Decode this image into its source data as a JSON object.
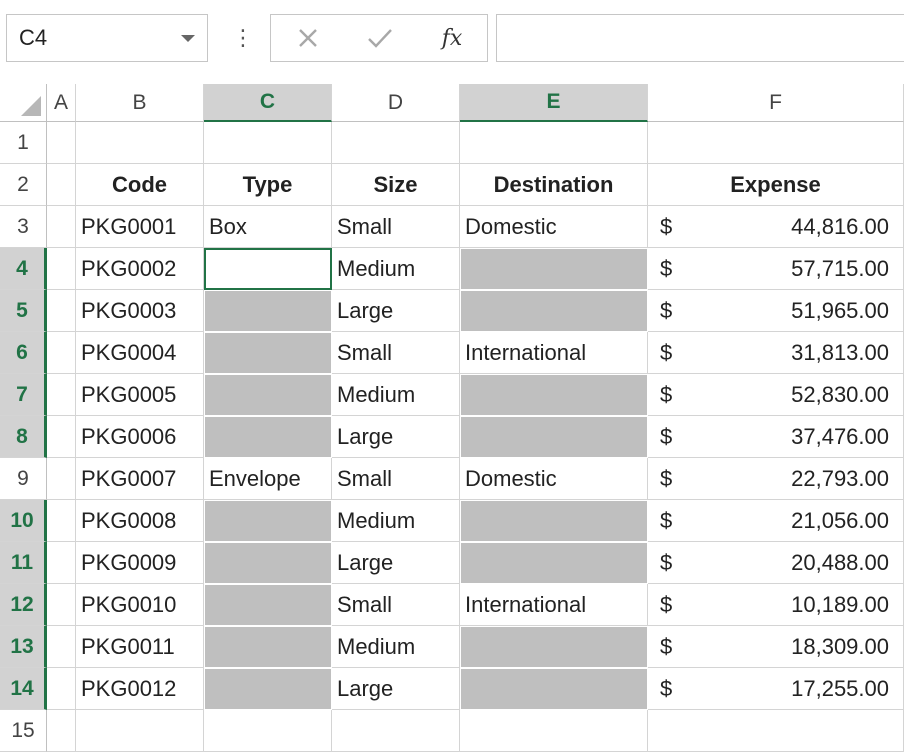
{
  "formula_bar": {
    "name_box": "C4",
    "more_icon": "vertical-dots",
    "cancel_icon": "x-icon",
    "enter_icon": "check-icon",
    "fx_label": "fx",
    "formula_value": ""
  },
  "columns": [
    "A",
    "B",
    "C",
    "D",
    "E",
    "F"
  ],
  "selected_columns": [
    "C",
    "E"
  ],
  "rows": [
    "1",
    "2",
    "3",
    "4",
    "5",
    "6",
    "7",
    "8",
    "9",
    "10",
    "11",
    "12",
    "13",
    "14",
    "15"
  ],
  "selected_rows": [
    "4",
    "5",
    "6",
    "7",
    "8",
    "10",
    "11",
    "12",
    "13",
    "14"
  ],
  "headers": {
    "code": "Code",
    "type": "Type",
    "size": "Size",
    "destination": "Destination",
    "expense": "Expense"
  },
  "table": [
    {
      "code": "PKG0001",
      "type": "Box",
      "size": "Small",
      "destination": "Domestic",
      "currency": "$",
      "expense": "44,816.00"
    },
    {
      "code": "PKG0002",
      "type": "",
      "size": "Medium",
      "destination": "",
      "currency": "$",
      "expense": "57,715.00"
    },
    {
      "code": "PKG0003",
      "type": "",
      "size": "Large",
      "destination": "",
      "currency": "$",
      "expense": "51,965.00"
    },
    {
      "code": "PKG0004",
      "type": "",
      "size": "Small",
      "destination": "International",
      "currency": "$",
      "expense": "31,813.00"
    },
    {
      "code": "PKG0005",
      "type": "",
      "size": "Medium",
      "destination": "",
      "currency": "$",
      "expense": "52,830.00"
    },
    {
      "code": "PKG0006",
      "type": "",
      "size": "Large",
      "destination": "",
      "currency": "$",
      "expense": "37,476.00"
    },
    {
      "code": "PKG0007",
      "type": "Envelope",
      "size": "Small",
      "destination": "Domestic",
      "currency": "$",
      "expense": "22,793.00"
    },
    {
      "code": "PKG0008",
      "type": "",
      "size": "Medium",
      "destination": "",
      "currency": "$",
      "expense": "21,056.00"
    },
    {
      "code": "PKG0009",
      "type": "",
      "size": "Large",
      "destination": "",
      "currency": "$",
      "expense": "20,488.00"
    },
    {
      "code": "PKG0010",
      "type": "",
      "size": "Small",
      "destination": "International",
      "currency": "$",
      "expense": "10,189.00"
    },
    {
      "code": "PKG0011",
      "type": "",
      "size": "Medium",
      "destination": "",
      "currency": "$",
      "expense": "18,309.00"
    },
    {
      "code": "PKG0012",
      "type": "",
      "size": "Large",
      "destination": "",
      "currency": "$",
      "expense": "17,255.00"
    }
  ],
  "colors": {
    "selection_green": "#217346",
    "selected_header_bg": "#d2d2d2",
    "blank_cell_fill": "#bfbfbf",
    "gridline": "#d4d4d4"
  }
}
